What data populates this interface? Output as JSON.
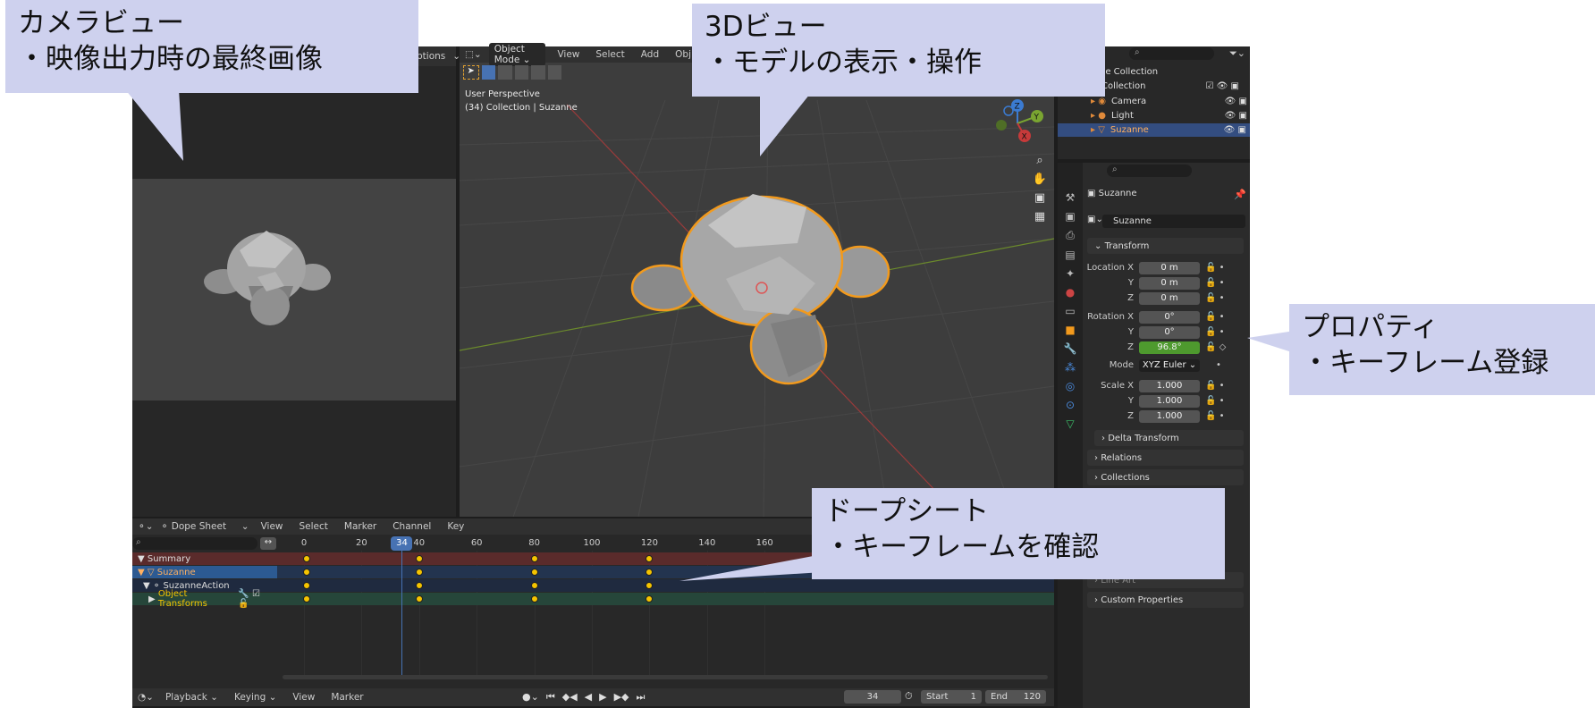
{
  "callouts": {
    "camera": {
      "title": "カメラビュー",
      "desc": "・映像出力時の最終画像"
    },
    "view3d": {
      "title": "3Dビュー",
      "desc": "・モデルの表示・操作"
    },
    "properties": {
      "title": "プロパティ",
      "desc": "・キーフレーム登録"
    },
    "dopesheet": {
      "title": "ドープシート",
      "desc": "・キーフレームを確認"
    }
  },
  "camera_header": {
    "options": "ptions"
  },
  "view3d": {
    "mode": "Object Mode",
    "menus": [
      "View",
      "Select",
      "Add",
      "Obj"
    ],
    "overlay_line1": "User Perspective",
    "overlay_line2": "(34) Collection | Suzanne",
    "gizmo_labels": [
      "Z",
      "Y",
      "X"
    ]
  },
  "outliner": {
    "items": [
      {
        "label": "ne Collection"
      },
      {
        "label": "Collection"
      },
      {
        "label": "Camera"
      },
      {
        "label": "Light"
      },
      {
        "label": "Suzanne"
      }
    ]
  },
  "properties": {
    "object_name": "Suzanne",
    "data_name": "Suzanne",
    "section_transform": "Transform",
    "location_label": "Location X",
    "rotation_label": "Rotation X",
    "scale_label": "Scale X",
    "y_label": "Y",
    "z_label": "Z",
    "mode_label": "Mode",
    "mode_value": "XYZ Euler",
    "location": [
      "0 m",
      "0 m",
      "0 m"
    ],
    "rotation": [
      "0°",
      "0°",
      "96.8°"
    ],
    "scale": [
      "1.000",
      "1.000",
      "1.000"
    ],
    "sections": [
      "Delta Transform",
      "Relations",
      "Collections",
      "Line Art",
      "Custom Properties"
    ],
    "accent_keyed": "#4e9a2e"
  },
  "dopesheet": {
    "editor": "Dope Sheet",
    "menus": [
      "View",
      "Select",
      "Marker",
      "Channel",
      "Key"
    ],
    "ticks": [
      "0",
      "20",
      "40",
      "60",
      "80",
      "100",
      "120",
      "140",
      "160"
    ],
    "current_frame": "34",
    "channels": [
      "Summary",
      "Suzanne",
      "SuzanneAction",
      "Object Transforms"
    ],
    "keyframes": [
      1,
      40,
      80,
      120
    ]
  },
  "timeline": {
    "menus": [
      "Playback",
      "Keying",
      "View",
      "Marker"
    ],
    "frame": "34",
    "start_label": "Start",
    "start": "1",
    "end_label": "End",
    "end": "120"
  }
}
